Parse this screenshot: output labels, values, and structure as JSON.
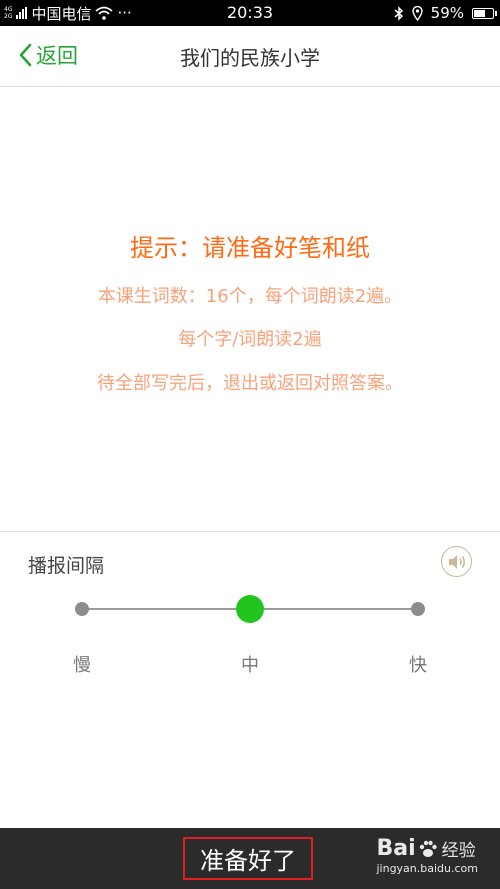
{
  "status_bar": {
    "net_top": "4G",
    "net_bottom": "2G",
    "carrier": "中国电信",
    "more": "···",
    "time": "20:33",
    "battery": "59%",
    "battery_level": 0.59
  },
  "header": {
    "back_label": "返回",
    "title": "我们的民族小学"
  },
  "tip": {
    "title": "提示：请准备好笔和纸",
    "lines": [
      "本课生词数：16个，每个词朗读2遍。",
      "每个字/词朗读2遍",
      "待全部写完后，退出或返回对照答案。"
    ]
  },
  "settings": {
    "label": "播报间隔",
    "speeds": [
      "慢",
      "中",
      "快"
    ],
    "selected_index": 1
  },
  "bottom": {
    "ready_button": "准备好了"
  },
  "watermark": {
    "logo_left": "Bai",
    "logo_right": "经验",
    "url": "jingyan.baidu.com"
  },
  "colors": {
    "accent_green": "#26a538",
    "knob_green": "#22c51e",
    "tip_title": "#ff6a13",
    "tip_text": "#f8a27b",
    "highlight_red": "#e02020"
  },
  "icons": {
    "back": "chevron-left-icon",
    "speaker": "speaker-icon",
    "wifi": "wifi-icon",
    "bluetooth": "bluetooth-icon",
    "location": "location-icon",
    "battery": "battery-icon",
    "signal": "signal-icon"
  }
}
